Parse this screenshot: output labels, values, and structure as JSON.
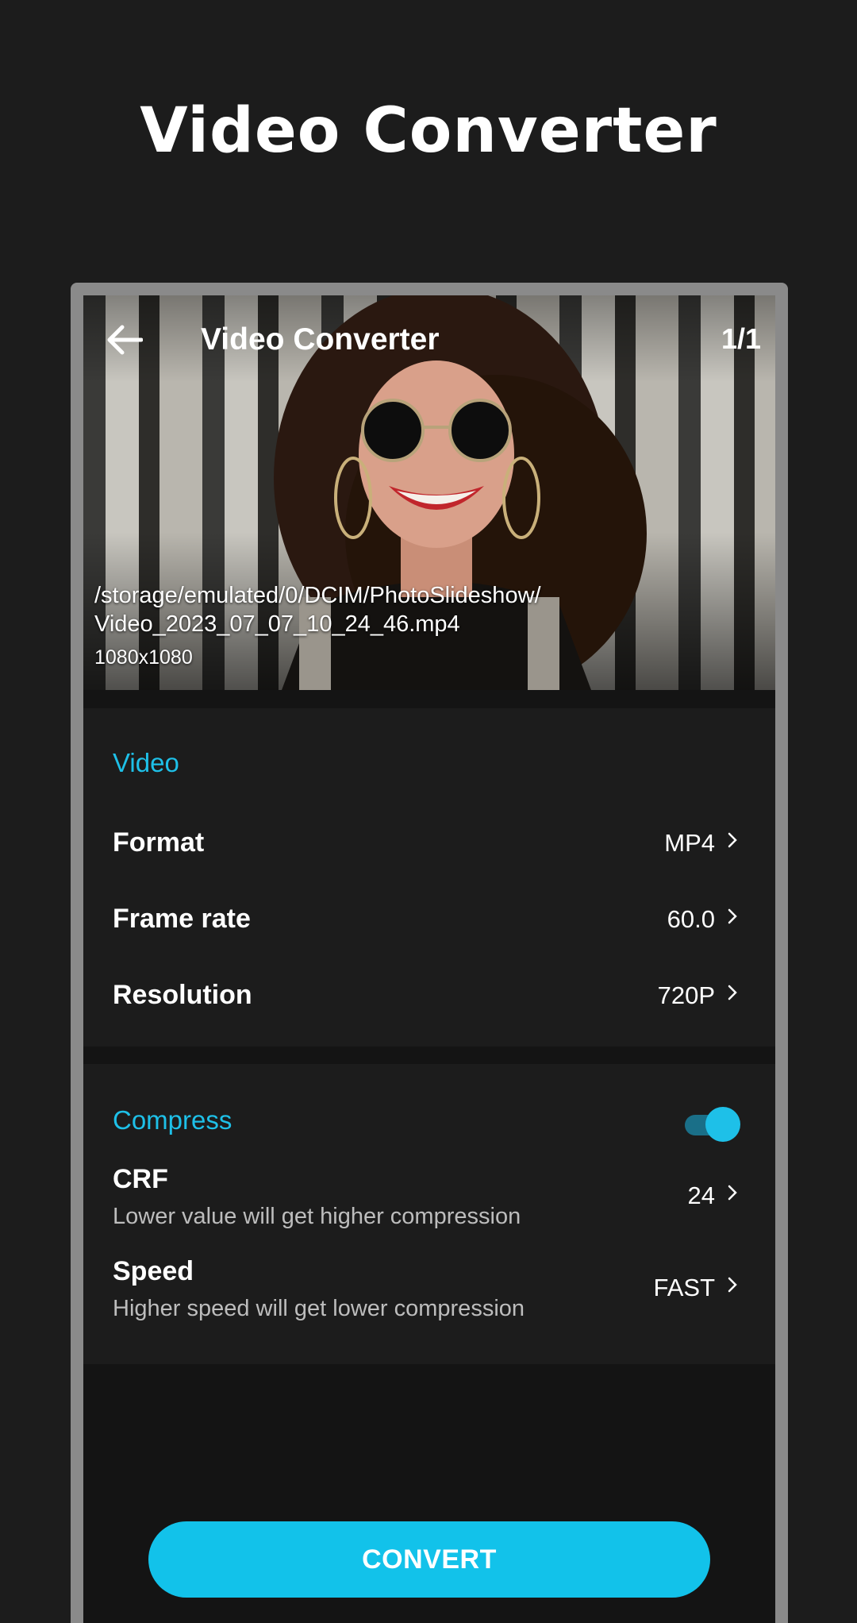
{
  "promo": {
    "title": "Video Converter"
  },
  "appbar": {
    "title": "Video Converter",
    "counter": "1/1"
  },
  "preview": {
    "path_line1": "/storage/emulated/0/DCIM/PhotoSlideshow/",
    "path_line2": "Video_2023_07_07_10_24_46.mp4",
    "resolution": "1080x1080"
  },
  "video_section": {
    "header": "Video",
    "rows": [
      {
        "label": "Format",
        "value": "MP4"
      },
      {
        "label": "Frame rate",
        "value": "60.0"
      },
      {
        "label": "Resolution",
        "value": "720P"
      }
    ]
  },
  "compress_section": {
    "header": "Compress",
    "toggle_on": true,
    "rows": [
      {
        "label": "CRF",
        "sub": "Lower value will get higher compression",
        "value": "24"
      },
      {
        "label": "Speed",
        "sub": "Higher speed will get lower compression",
        "value": "FAST"
      }
    ]
  },
  "actions": {
    "convert_label": "CONVERT"
  },
  "colors": {
    "accent": "#1ec0e8",
    "button": "#12c2ea",
    "background": "#1c1c1c"
  },
  "icons": {
    "back": "arrow-left-icon",
    "chevron": "chevron-right-icon"
  }
}
